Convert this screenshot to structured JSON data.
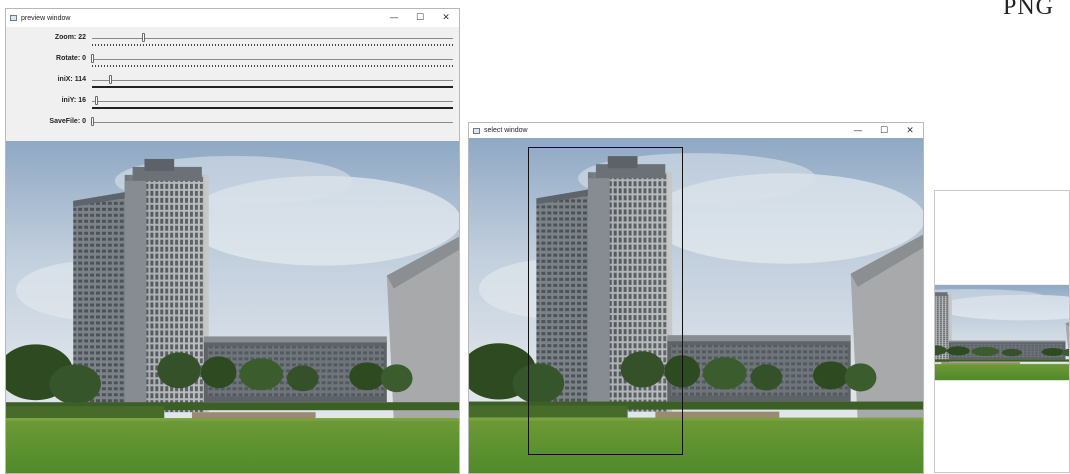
{
  "preview_window": {
    "title": "preview window",
    "controls": {
      "minimize": "—",
      "maximize": "☐",
      "close": "✕"
    },
    "trackbars": [
      {
        "label": "Zoom: 22",
        "fraction": 0.14,
        "ticks": "sparse"
      },
      {
        "label": "Rotate: 0",
        "fraction": 0.0,
        "ticks": "dense"
      },
      {
        "label": "iniX: 114",
        "fraction": 0.05,
        "ticks": "dense"
      },
      {
        "label": "iniY: 16",
        "fraction": 0.01,
        "ticks": "dense"
      },
      {
        "label": "SaveFile: 0",
        "fraction": 0.0,
        "ticks": "none"
      }
    ]
  },
  "select_window": {
    "title": "select window",
    "controls": {
      "minimize": "—",
      "maximize": "☐",
      "close": "✕"
    }
  },
  "partial_text": "PNG",
  "colors": {
    "sky": "#b9c9db",
    "building": "#8d949b",
    "grass": "#5d8f2f",
    "trees": "#2f4a22",
    "frame": "#111111"
  }
}
